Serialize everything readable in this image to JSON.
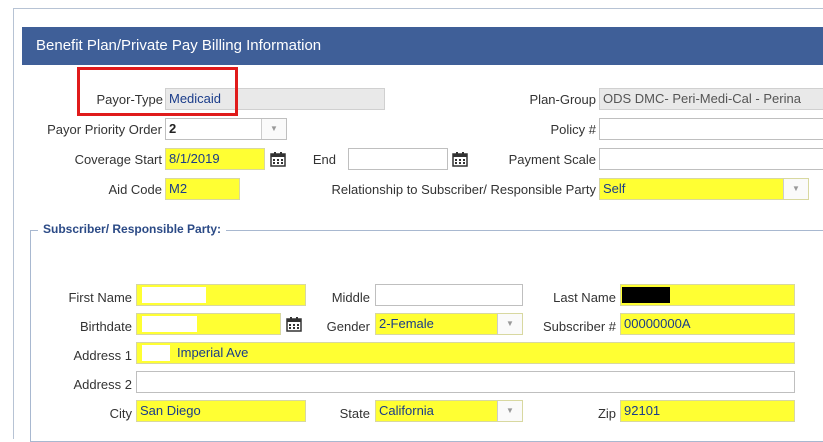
{
  "header": {
    "title": "Benefit Plan/Private Pay Billing Information"
  },
  "payor_type": {
    "label": "Payor-Type",
    "value": "Medicaid"
  },
  "plan_group": {
    "label": "Plan-Group",
    "value": "ODS DMC- Peri-Medi-Cal - Perina"
  },
  "payor_priority": {
    "label": "Payor Priority Order",
    "value": "2"
  },
  "policy": {
    "label": "Policy #",
    "value": ""
  },
  "coverage_start": {
    "label": "Coverage Start",
    "value": "8/1/2019"
  },
  "end": {
    "label": "End",
    "value": ""
  },
  "payment_scale": {
    "label": "Payment Scale",
    "value": ""
  },
  "aid_code": {
    "label": "Aid Code",
    "value": "M2"
  },
  "relationship": {
    "label": "Relationship to Subscriber/ Responsible Party",
    "value": "Self"
  },
  "subscriber": {
    "section_title": "Subscriber/ Responsible Party:",
    "first_name": {
      "label": "First Name",
      "value": ""
    },
    "middle": {
      "label": "Middle",
      "value": ""
    },
    "last_name": {
      "label": "Last Name",
      "value": ""
    },
    "birthdate": {
      "label": "Birthdate",
      "value": ""
    },
    "gender": {
      "label": "Gender",
      "value": "2-Female"
    },
    "subscriber_no": {
      "label": "Subscriber #",
      "value": "00000000A"
    },
    "address1": {
      "label": "Address 1",
      "value": "Imperial Ave"
    },
    "address2": {
      "label": "Address 2",
      "value": ""
    },
    "city": {
      "label": "City",
      "value": "San Diego"
    },
    "state": {
      "label": "State",
      "value": "California"
    },
    "zip": {
      "label": "Zip",
      "value": "92101"
    }
  },
  "colors": {
    "header": "#3f5f98",
    "required_field": "#ffff33",
    "highlight_box": "#e01b1b"
  }
}
